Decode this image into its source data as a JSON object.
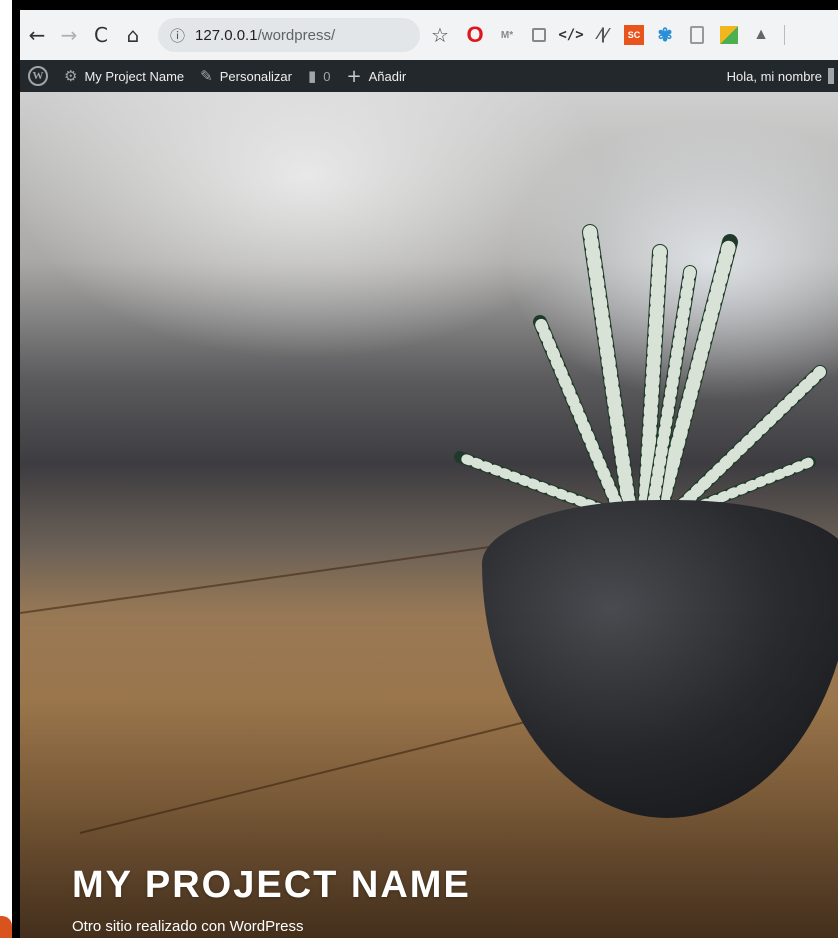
{
  "browser": {
    "back_icon": "←",
    "forward_icon": "→",
    "reload_icon": "C",
    "home_icon": "⌂",
    "info_icon": "ⓘ",
    "url_host": "127.0.0.1",
    "url_path": "/wordpress/",
    "bookmark_icon": "☆",
    "extensions": {
      "opera": "O",
      "ms": "M*",
      "code": "</>",
      "pulse": "⁄|⁄",
      "sc": "SC",
      "blue": "✾",
      "drive": "▲"
    }
  },
  "adminbar": {
    "wp_logo": "W",
    "site_icon": "⚙",
    "site_name": "My Project Name",
    "customize_icon": "✎",
    "customize_label": "Personalizar",
    "comments_icon": "▮",
    "comments_count": "0",
    "new_icon": "+",
    "new_label": "Añadir",
    "greeting": "Hola, mi nombre"
  },
  "hero": {
    "site_title": "MY PROJECT NAME",
    "tagline": "Otro sitio realizado con WordPress"
  }
}
